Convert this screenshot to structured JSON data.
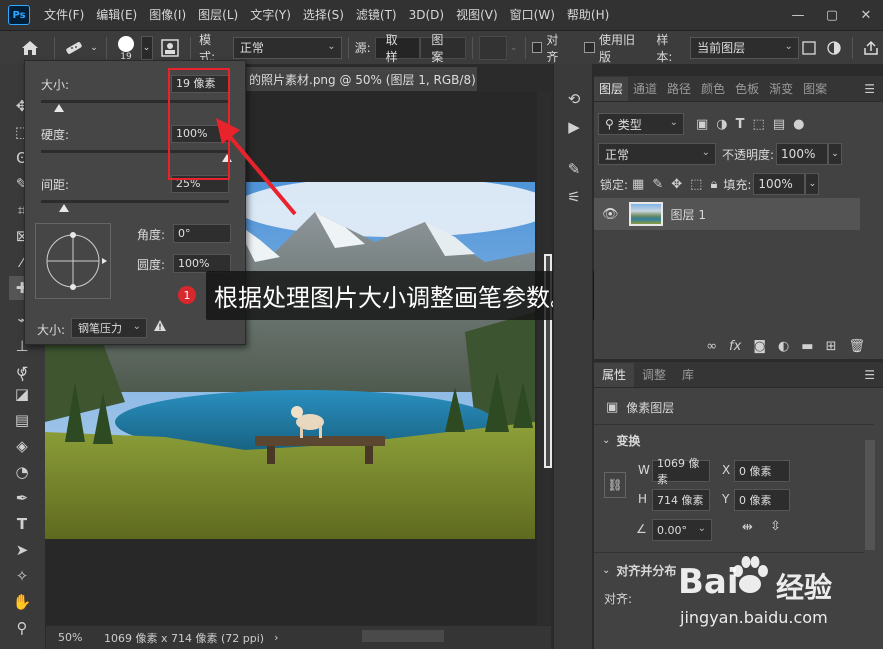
{
  "menubar": {
    "logo": "Ps",
    "items": [
      "文件(F)",
      "编辑(E)",
      "图像(I)",
      "图层(L)",
      "文字(Y)",
      "选择(S)",
      "滤镜(T)",
      "3D(D)",
      "视图(V)",
      "窗口(W)",
      "帮助(H)"
    ],
    "controls": {
      "minimize": "—",
      "maximize": "▢",
      "close": "✕"
    }
  },
  "options": {
    "brush_size": "19",
    "mode_label": "模式:",
    "mode_value": "正常",
    "source_label": "源:",
    "source_sample": "取样",
    "source_pattern": "图案",
    "align_label": "对齐",
    "legacy_label": "使用旧版",
    "sample_label": "样本:",
    "sample_value": "当前图层"
  },
  "document": {
    "tab_title": "的照片素材.png @ 50% (图层 1, RGB/8)",
    "zoom": "50%",
    "info": "1069 像素 x 714 像素 (72 ppi)"
  },
  "brush_popup": {
    "size_label": "大小:",
    "size_value": "19 像素",
    "hardness_label": "硬度:",
    "hardness_value": "100%",
    "spacing_label": "间距:",
    "spacing_value": "25%",
    "angle_label": "角度:",
    "angle_value": "0°",
    "roundness_label": "圆度:",
    "roundness_value": "100%",
    "footer_size_label": "大小:",
    "footer_pressure": "钢笔压力"
  },
  "callout": {
    "badge": "1",
    "text": "根据处理图片大小调整画笔参数。"
  },
  "layers_panel": {
    "tabs": [
      "图层",
      "通道",
      "路径",
      "颜色",
      "色板",
      "渐变",
      "图案"
    ],
    "filter_value": "类型",
    "blend_value": "正常",
    "opacity_label": "不透明度:",
    "opacity_value": "100%",
    "lock_label": "锁定:",
    "fill_label": "填充:",
    "fill_value": "100%",
    "layer_name": "图层 1"
  },
  "properties_panel": {
    "tabs": [
      "属性",
      "调整",
      "库"
    ],
    "type_label": "像素图层",
    "transform_title": "变换",
    "w_label": "W",
    "w_value": "1069 像素",
    "h_label": "H",
    "h_value": "714 像素",
    "x_label": "X",
    "x_value": "0 像素",
    "y_label": "Y",
    "y_value": "0 像素",
    "angle_value": "0.00°",
    "align_title": "对齐并分布",
    "align_label": "对齐:"
  },
  "watermark": {
    "brand": "Bai",
    "brand2": "经验",
    "url": "jingyan.baidu.com"
  },
  "colors": {
    "accent_red": "#e8232b",
    "ps_blue": "#31a8ff"
  }
}
